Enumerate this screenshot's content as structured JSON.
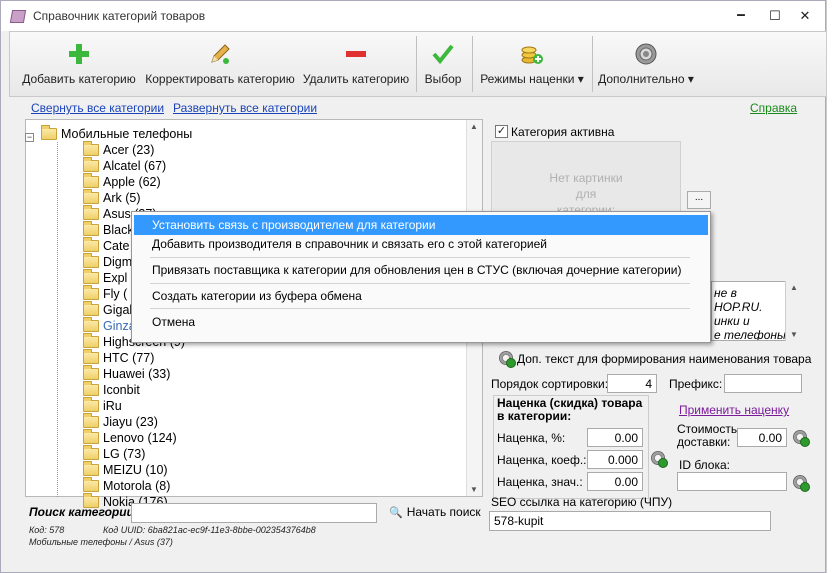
{
  "window": {
    "title": "Справочник категорий товаров",
    "min_glyph": "🗕",
    "max_glyph": "☐",
    "close_glyph": "✕"
  },
  "toolbar": {
    "add": "Добавить категорию",
    "edit": "Корректировать категорию",
    "delete": "Удалить категорию",
    "select": "Выбор",
    "markup_modes": "Режимы наценки",
    "more": "Дополнительно",
    "dropdown_glyph": "▾"
  },
  "links": {
    "collapse_all": "Свернуть все категории",
    "expand_all": "Развернуть все категории",
    "help": "Справка"
  },
  "tree": {
    "root": "Мобильные телефоны",
    "expander_glyph": "−",
    "items": [
      "Acer (23)",
      "Alcatel (67)",
      "Apple (62)",
      "Ark (5)",
      "Asus (37)",
      "Black",
      "Cate",
      "Digm",
      "Expl",
      "Fly (",
      "Gigal",
      "Ginza",
      "Highscreen (9)",
      "HTC (77)",
      "Huawei (33)",
      "Iconbit",
      "iRu",
      "Jiayu (23)",
      "Lenovo (124)",
      "LG (73)",
      "MEIZU (10)",
      "Motorola (8)",
      "Nokia (176)"
    ]
  },
  "context_menu": {
    "items": [
      "Установить связь с производителем для категории",
      "Добавить производителя в справочник и связать его с этой категорией",
      "Привязать поставщика к категории для обновления цен в СТУС (включая дочерние категории)",
      "Создать категории из буфера обмена",
      "Отмена"
    ]
  },
  "search": {
    "label": "Поиск категории:",
    "value": "",
    "button": "Начать поиск"
  },
  "status": {
    "code": "Код: 578",
    "uuid": "Код UUID: 6ba821ac-ec9f-11e3-8bbe-0023543764b8",
    "path": "Мобильные телефоны / Asus (37)"
  },
  "details": {
    "active_label": "Категория активна",
    "active_checked": "✓",
    "no_image_l1": "Нет картинки",
    "no_image_l2": "для",
    "no_image_l3": "категории:",
    "browse": "...",
    "desc_l1": "не в",
    "desc_l2": "HOP.RU.",
    "desc_l3": "инки и",
    "desc_l4": "е телефоны -",
    "extra_text": "Доп. текст для формирования наименования товара",
    "sort_label": "Порядок сортировки:",
    "sort_value": "4",
    "prefix_label": "Префикс:",
    "prefix_value": "",
    "markup_group_l1": "Наценка (скидка) товара",
    "markup_group_l2": "в категории:",
    "markup_pct_label": "Наценка, %:",
    "markup_pct": "0.00",
    "markup_coef_label": "Наценка, коеф.:",
    "markup_coef": "0.000",
    "markup_val_label": "Наценка, знач.:",
    "markup_val": "0.00",
    "apply_markup": "Применить наценку",
    "delivery_label_l1": "Стоимость",
    "delivery_label_l2": "доставки:",
    "delivery_value": "0.00",
    "block_id_label": "ID блока:",
    "block_id_value": "",
    "seo_label": "SEO ссылка на категорию (ЧПУ)",
    "seo_value": "578-kupit"
  },
  "colors": {
    "accent": "#3399ff",
    "link": "#1a44b8",
    "help_link": "#1a8a1a"
  }
}
